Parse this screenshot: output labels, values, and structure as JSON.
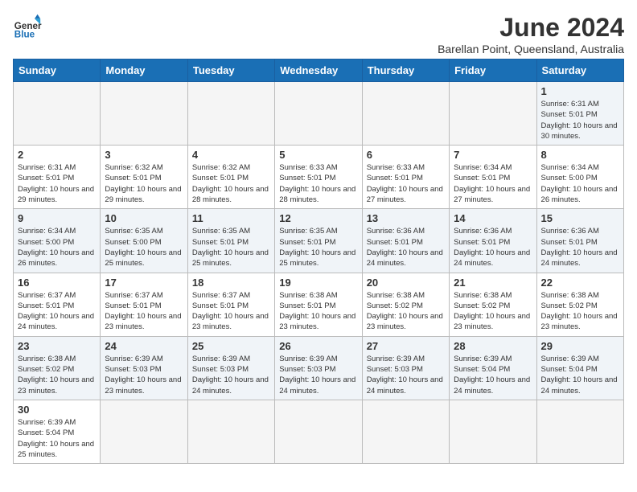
{
  "header": {
    "logo_general": "General",
    "logo_blue": "Blue",
    "month_title": "June 2024",
    "subtitle": "Barellan Point, Queensland, Australia"
  },
  "days_of_week": [
    "Sunday",
    "Monday",
    "Tuesday",
    "Wednesday",
    "Thursday",
    "Friday",
    "Saturday"
  ],
  "weeks": [
    [
      {
        "day": "",
        "info": ""
      },
      {
        "day": "",
        "info": ""
      },
      {
        "day": "",
        "info": ""
      },
      {
        "day": "",
        "info": ""
      },
      {
        "day": "",
        "info": ""
      },
      {
        "day": "",
        "info": ""
      },
      {
        "day": "1",
        "info": "Sunrise: 6:31 AM\nSunset: 5:01 PM\nDaylight: 10 hours and 30 minutes."
      }
    ],
    [
      {
        "day": "2",
        "info": "Sunrise: 6:31 AM\nSunset: 5:01 PM\nDaylight: 10 hours and 29 minutes."
      },
      {
        "day": "3",
        "info": "Sunrise: 6:32 AM\nSunset: 5:01 PM\nDaylight: 10 hours and 29 minutes."
      },
      {
        "day": "4",
        "info": "Sunrise: 6:32 AM\nSunset: 5:01 PM\nDaylight: 10 hours and 28 minutes."
      },
      {
        "day": "5",
        "info": "Sunrise: 6:33 AM\nSunset: 5:01 PM\nDaylight: 10 hours and 28 minutes."
      },
      {
        "day": "6",
        "info": "Sunrise: 6:33 AM\nSunset: 5:01 PM\nDaylight: 10 hours and 27 minutes."
      },
      {
        "day": "7",
        "info": "Sunrise: 6:34 AM\nSunset: 5:01 PM\nDaylight: 10 hours and 27 minutes."
      },
      {
        "day": "8",
        "info": "Sunrise: 6:34 AM\nSunset: 5:00 PM\nDaylight: 10 hours and 26 minutes."
      }
    ],
    [
      {
        "day": "9",
        "info": "Sunrise: 6:34 AM\nSunset: 5:00 PM\nDaylight: 10 hours and 26 minutes."
      },
      {
        "day": "10",
        "info": "Sunrise: 6:35 AM\nSunset: 5:00 PM\nDaylight: 10 hours and 25 minutes."
      },
      {
        "day": "11",
        "info": "Sunrise: 6:35 AM\nSunset: 5:01 PM\nDaylight: 10 hours and 25 minutes."
      },
      {
        "day": "12",
        "info": "Sunrise: 6:35 AM\nSunset: 5:01 PM\nDaylight: 10 hours and 25 minutes."
      },
      {
        "day": "13",
        "info": "Sunrise: 6:36 AM\nSunset: 5:01 PM\nDaylight: 10 hours and 24 minutes."
      },
      {
        "day": "14",
        "info": "Sunrise: 6:36 AM\nSunset: 5:01 PM\nDaylight: 10 hours and 24 minutes."
      },
      {
        "day": "15",
        "info": "Sunrise: 6:36 AM\nSunset: 5:01 PM\nDaylight: 10 hours and 24 minutes."
      }
    ],
    [
      {
        "day": "16",
        "info": "Sunrise: 6:37 AM\nSunset: 5:01 PM\nDaylight: 10 hours and 24 minutes."
      },
      {
        "day": "17",
        "info": "Sunrise: 6:37 AM\nSunset: 5:01 PM\nDaylight: 10 hours and 23 minutes."
      },
      {
        "day": "18",
        "info": "Sunrise: 6:37 AM\nSunset: 5:01 PM\nDaylight: 10 hours and 23 minutes."
      },
      {
        "day": "19",
        "info": "Sunrise: 6:38 AM\nSunset: 5:01 PM\nDaylight: 10 hours and 23 minutes."
      },
      {
        "day": "20",
        "info": "Sunrise: 6:38 AM\nSunset: 5:02 PM\nDaylight: 10 hours and 23 minutes."
      },
      {
        "day": "21",
        "info": "Sunrise: 6:38 AM\nSunset: 5:02 PM\nDaylight: 10 hours and 23 minutes."
      },
      {
        "day": "22",
        "info": "Sunrise: 6:38 AM\nSunset: 5:02 PM\nDaylight: 10 hours and 23 minutes."
      }
    ],
    [
      {
        "day": "23",
        "info": "Sunrise: 6:38 AM\nSunset: 5:02 PM\nDaylight: 10 hours and 23 minutes."
      },
      {
        "day": "24",
        "info": "Sunrise: 6:39 AM\nSunset: 5:03 PM\nDaylight: 10 hours and 23 minutes."
      },
      {
        "day": "25",
        "info": "Sunrise: 6:39 AM\nSunset: 5:03 PM\nDaylight: 10 hours and 24 minutes."
      },
      {
        "day": "26",
        "info": "Sunrise: 6:39 AM\nSunset: 5:03 PM\nDaylight: 10 hours and 24 minutes."
      },
      {
        "day": "27",
        "info": "Sunrise: 6:39 AM\nSunset: 5:03 PM\nDaylight: 10 hours and 24 minutes."
      },
      {
        "day": "28",
        "info": "Sunrise: 6:39 AM\nSunset: 5:04 PM\nDaylight: 10 hours and 24 minutes."
      },
      {
        "day": "29",
        "info": "Sunrise: 6:39 AM\nSunset: 5:04 PM\nDaylight: 10 hours and 24 minutes."
      }
    ],
    [
      {
        "day": "30",
        "info": "Sunrise: 6:39 AM\nSunset: 5:04 PM\nDaylight: 10 hours and 25 minutes."
      },
      {
        "day": "",
        "info": ""
      },
      {
        "day": "",
        "info": ""
      },
      {
        "day": "",
        "info": ""
      },
      {
        "day": "",
        "info": ""
      },
      {
        "day": "",
        "info": ""
      },
      {
        "day": "",
        "info": ""
      }
    ]
  ]
}
